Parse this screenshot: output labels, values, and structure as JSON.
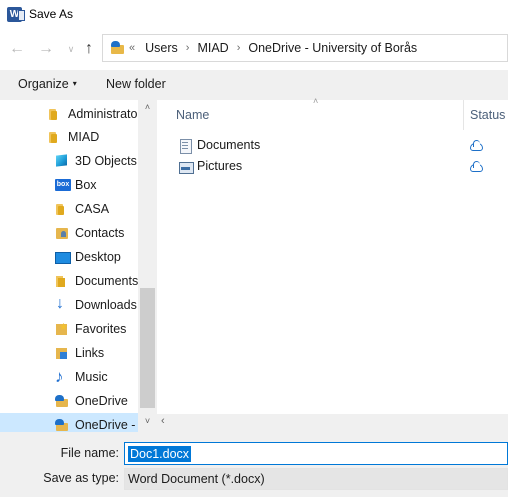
{
  "window": {
    "title": "Save As",
    "app_icon_letter": "W"
  },
  "nav": {
    "back": "←",
    "forward": "→",
    "recent": "∨",
    "up": "↑"
  },
  "address": {
    "overflow": "«",
    "separator": "›",
    "crumbs": [
      "Users",
      "MIAD",
      "OneDrive - University of Borås"
    ]
  },
  "toolbar": {
    "organize": "Organize",
    "organize_caret": "▾",
    "new_folder": "New folder"
  },
  "sidebar": {
    "items": [
      {
        "label": "Administrator",
        "icon": "folder-icon",
        "indent": 1
      },
      {
        "label": "MIAD",
        "icon": "folder-icon",
        "indent": 1
      },
      {
        "label": "3D Objects",
        "icon": "3d-objects-icon",
        "indent": 2
      },
      {
        "label": "Box",
        "icon": "box-icon",
        "indent": 2
      },
      {
        "label": "CASA",
        "icon": "folder-icon",
        "indent": 2
      },
      {
        "label": "Contacts",
        "icon": "contacts-icon",
        "indent": 2
      },
      {
        "label": "Desktop",
        "icon": "desktop-icon",
        "indent": 2
      },
      {
        "label": "Documents",
        "icon": "documents-folder-icon",
        "indent": 2
      },
      {
        "label": "Downloads",
        "icon": "download-icon",
        "indent": 2
      },
      {
        "label": "Favorites",
        "icon": "favorites-icon",
        "indent": 2
      },
      {
        "label": "Links",
        "icon": "links-icon",
        "indent": 2
      },
      {
        "label": "Music",
        "icon": "music-icon",
        "indent": 2
      },
      {
        "label": "OneDrive",
        "icon": "onedrive-folder-icon",
        "indent": 2
      },
      {
        "label": "OneDrive - U",
        "icon": "onedrive-folder-icon",
        "indent": 2,
        "selected": true
      }
    ],
    "scroll_up": "˄",
    "scroll_down": "˅"
  },
  "list": {
    "sort_indicator": "˄",
    "columns": {
      "name": "Name",
      "status": "Status"
    },
    "rows": [
      {
        "name": "Documents",
        "icon": "document-library-icon",
        "status": "cloud-icon"
      },
      {
        "name": "Pictures",
        "icon": "pictures-icon",
        "status": "cloud-icon"
      }
    ],
    "scroll_left": "‹"
  },
  "form": {
    "file_name_label": "File name:",
    "file_name_value": "Doc1.docx",
    "save_as_type_label": "Save as type:",
    "save_as_type_value": "Word Document (*.docx)"
  },
  "colors": {
    "accent": "#0078d7",
    "selection": "#cce8ff",
    "toolbar_bg": "#f0f0f0"
  }
}
